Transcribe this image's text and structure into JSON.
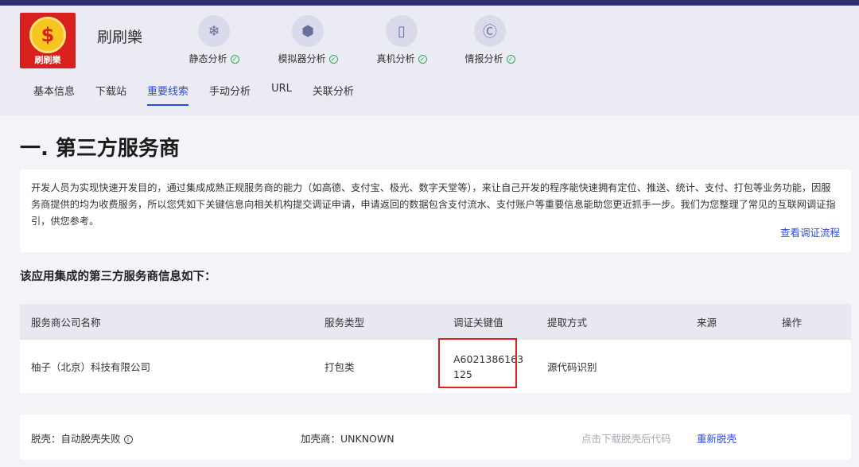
{
  "app": {
    "name": "刷刷樂",
    "logo_text": "刷刷樂",
    "logo_symbol": "$"
  },
  "analysis_items": [
    {
      "label": "静态分析",
      "icon": "snowflake-icon"
    },
    {
      "label": "模拟器分析",
      "icon": "cube-icon"
    },
    {
      "label": "真机分析",
      "icon": "phone-icon"
    },
    {
      "label": "情报分析",
      "icon": "c-icon"
    }
  ],
  "tabs": [
    "基本信息",
    "下载站",
    "重要线索",
    "手动分析",
    "URL",
    "关联分析"
  ],
  "active_tab": "重要线索",
  "section": {
    "title": "一. 第三方服务商",
    "description": "开发人员为实现快速开发目的，通过集成成熟正规服务商的能力（如高德、支付宝、极光、数字天堂等），来让自己开发的程序能快速拥有定位、推送、统计、支付、打包等业务功能，因服务商提供的均为收费服务，所以您凭如下关键信息向相关机构提交调证申请，申请返回的数据包含支付流水、支付账户等重要信息能助您更近抓手一步。我们为您整理了常见的互联网调证指引，供您参考。",
    "link": "查看调证流程",
    "subtitle": "该应用集成的第三方服务商信息如下："
  },
  "table": {
    "headers": [
      "服务商公司名称",
      "服务类型",
      "调证关键值",
      "提取方式",
      "来源",
      "操作"
    ],
    "rows": [
      {
        "company": "柚子（北京）科技有限公司",
        "type": "打包类",
        "key": "A6021386163\n125",
        "method": "源代码识别",
        "source": "",
        "action": ""
      }
    ]
  },
  "bottom": {
    "unpack": "脱壳：自动脱壳失败",
    "packer": "加壳商：UNKNOWN",
    "download_hint": "点击下载脱壳后代码",
    "retry": "重新脱壳"
  },
  "colors": {
    "accent": "#2f4bd6",
    "highlight_box": "#e0201c",
    "success": "#33a853",
    "logo_bg": "#d8211e"
  }
}
